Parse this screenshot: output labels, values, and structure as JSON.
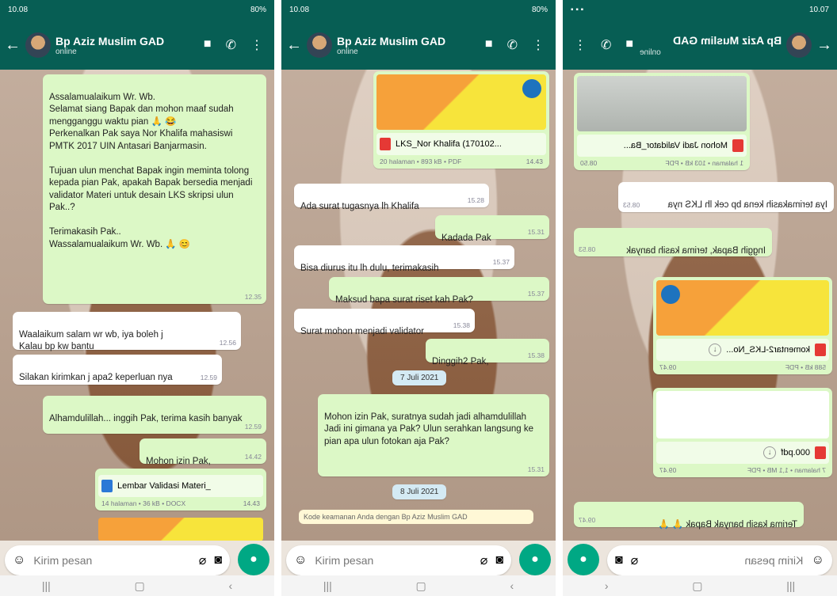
{
  "screens": [
    {
      "status_time": "10.08",
      "status_right": "80%",
      "contact_name": "Bp Aziz Muslim GAD",
      "contact_status": "online",
      "messages": [
        {
          "dir": "out",
          "text": "Assalamualaikum Wr. Wb.\nSelamat siang Bapak dan mohon maaf sudah mengganggu waktu pian 🙏 😂\nPerkenalkan Pak saya Nor Khalifa mahasiswi PMTK 2017 UIN Antasari Banjarmasin.\n\nTujuan ulun menchat Bapak ingin meminta tolong kepada pian Pak, apakah Bapak bersedia menjadi validator Materi untuk desain LKS skripsi ulun Pak..?\n\nTerimakasih Pak..\nWassalamualaikum Wr. Wb. 🙏 😊",
          "time": "12.35"
        },
        {
          "dir": "in",
          "text": "Waalaikum salam wr wb, iya boleh j\nKalau bp kw bantu",
          "time": "12.56"
        },
        {
          "dir": "in",
          "text": "Silakan kirimkan j apa2 keperluan nya",
          "time": "12.59"
        },
        {
          "dir": "out",
          "text": "Alhamdulillah... inggih Pak, terima kasih banyak",
          "time": "12.59"
        },
        {
          "dir": "out",
          "text": "Mohon izin Pak,",
          "time": "14.42"
        }
      ],
      "doc": {
        "name": "Lembar Validasi Materi_",
        "meta": "14 halaman • 36 kB • DOCX",
        "time": "14.43"
      },
      "composer_placeholder": "Kirim pesan"
    },
    {
      "status_time": "10.08",
      "status_right": "80%",
      "contact_name": "Bp Aziz Muslim GAD",
      "contact_status": "online",
      "doc": {
        "name": "LKS_Nor Khalifa (170102...",
        "meta": "20 halaman • 893 kB • PDF",
        "time": "14.43"
      },
      "messages": [
        {
          "dir": "in",
          "text": "Ada surat tugasnya lh Khalifa",
          "time": "15.28"
        },
        {
          "dir": "out",
          "text": "Kadada Pak",
          "time": "15.31"
        },
        {
          "dir": "in",
          "text": "Bisa diurus itu lh dulu, terimakasih",
          "time": "15.37"
        },
        {
          "dir": "out",
          "text": "Maksud bapa surat riset kah Pak?",
          "time": "15.37"
        },
        {
          "dir": "in",
          "text": "Surat mohon menjadi validator",
          "time": "15.38"
        },
        {
          "dir": "out",
          "text": "Dinggih2 Pak,",
          "time": "15.38"
        },
        {
          "dir": "out",
          "text": "Mohon izin Pak, suratnya sudah jadi alhamdulillah\nJadi ini gimana ya Pak? Ulun serahkan langsung ke pian apa ulun fotokan aja Pak?",
          "time": "15.31"
        }
      ],
      "date1": "7 Juli 2021",
      "date2": "8 Juli 2021",
      "security_note": "Kode keamanan Anda dengan Bp Aziz Muslim GAD",
      "composer_placeholder": "Kirim pesan"
    },
    {
      "status_time": "10.07",
      "contact_name": "Bp Aziz Muslim GAD",
      "contact_status": "online",
      "doc1": {
        "name": "Mohon Jadi Validator_Ba...",
        "meta": "1 halaman • 103 kB • PDF",
        "time": "08.50"
      },
      "messages": [
        {
          "dir": "in",
          "text": "Iya terimakasih kena bp cek lh LKS nya",
          "time": "08.53"
        },
        {
          "dir": "out",
          "text": "Inggih Bapak, terima kasih banyak",
          "time": "08.53"
        }
      ],
      "doc2": {
        "name": "komentar2-LKS_No...",
        "meta": "588 kB • PDF",
        "time": "09.47"
      },
      "doc3": {
        "name": "000.pdf",
        "meta": "7 halaman • 1,1 MB • PDF",
        "time": "09.47"
      },
      "last": {
        "text": "Terima kasih banyak Bapak 🙏 🙏",
        "time": "09.47"
      },
      "composer_placeholder": "Kirim pesan"
    }
  ]
}
